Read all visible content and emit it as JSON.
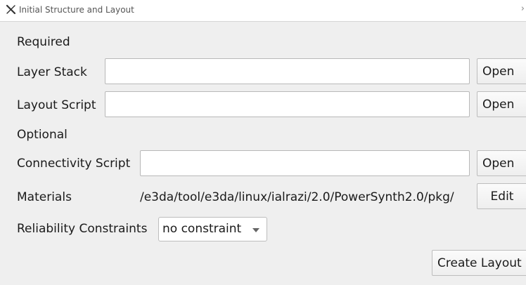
{
  "window": {
    "title": "Initial Structure and Layout",
    "app_icon": "x-app-icon",
    "chevron": "›"
  },
  "sections": {
    "required": "Required",
    "optional": "Optional"
  },
  "layer_stack": {
    "label": "Layer Stack",
    "value": "",
    "button": "Open"
  },
  "layout_script": {
    "label": "Layout Script",
    "value": "",
    "button": "Open"
  },
  "connectivity_script": {
    "label": "Connectivity Script",
    "value": "",
    "button": "Open"
  },
  "materials": {
    "label": "Materials",
    "path": "/e3da/tool/e3da/linux/ialrazi/2.0/PowerSynth2.0/pkg/",
    "button": "Edit"
  },
  "reliability": {
    "label": "Reliability Constraints",
    "selected": "no constraint"
  },
  "create_layout_button": "Create Layout"
}
